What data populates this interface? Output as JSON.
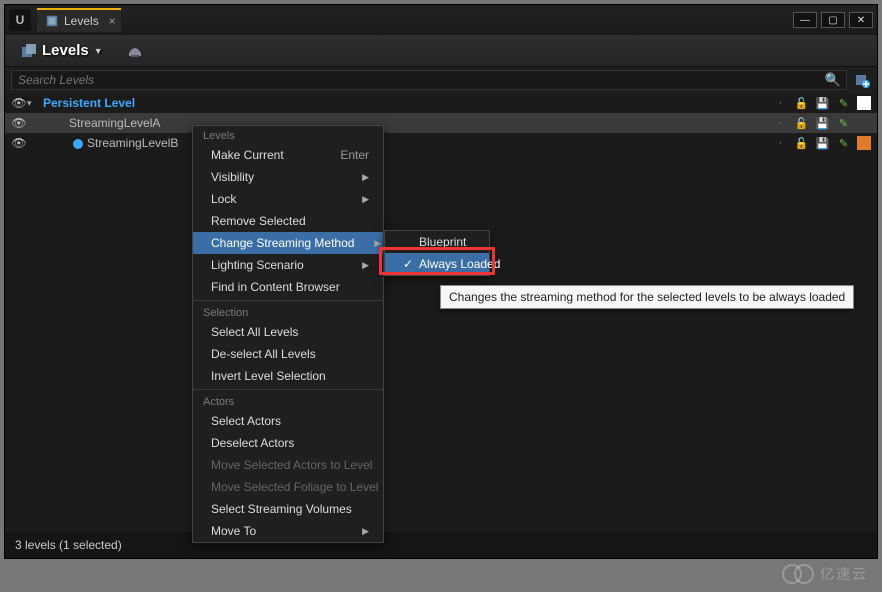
{
  "window": {
    "tab_label": "Levels"
  },
  "toolbar": {
    "levels_label": "Levels"
  },
  "search": {
    "placeholder": "Search Levels"
  },
  "rows": {
    "persistent": "Persistent Level",
    "a": "StreamingLevelA",
    "b": "StreamingLevelB"
  },
  "colors": {
    "a_swatch": "#f0c93a",
    "b_swatch": "#e07b2a",
    "b_dot": "#3da9fc"
  },
  "ctx": {
    "sections": {
      "levels": "Levels",
      "selection": "Selection",
      "actors": "Actors"
    },
    "make_current": "Make Current",
    "make_current_shortcut": "Enter",
    "visibility": "Visibility",
    "lock": "Lock",
    "remove_selected": "Remove Selected",
    "change_streaming": "Change Streaming Method",
    "lighting_scenario": "Lighting Scenario",
    "find_in_cb": "Find in Content Browser",
    "select_all": "Select All Levels",
    "deselect_all": "De-select All Levels",
    "invert": "Invert Level Selection",
    "select_actors": "Select Actors",
    "deselect_actors": "Deselect Actors",
    "move_actors": "Move Selected Actors to Level",
    "move_foliage": "Move Selected Foliage to Level",
    "select_volumes": "Select Streaming Volumes",
    "move_to": "Move To"
  },
  "submenu": {
    "blueprint": "Blueprint",
    "always_loaded": "Always Loaded"
  },
  "tooltip": "Changes the streaming method for the selected levels to be always loaded",
  "status": "3 levels (1 selected)",
  "watermark": "亿速云"
}
